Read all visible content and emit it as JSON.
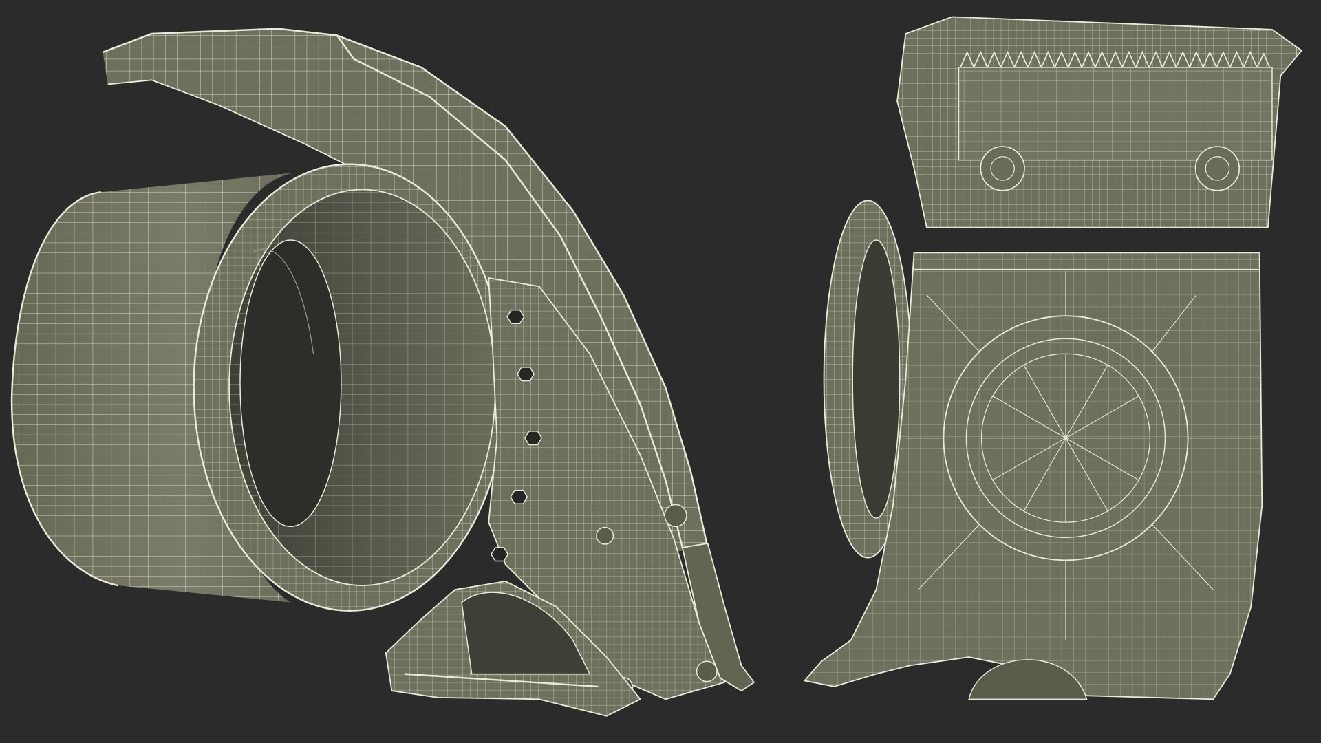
{
  "scene": {
    "description_visible_text": "",
    "palette": {
      "background": "#2b2b2b",
      "surface": "#6e705e",
      "surface_light": "#7b7d6a",
      "surface_dark": "#4c4e42",
      "shadow": "#3a3b33",
      "wire": "#e9ead8"
    },
    "objects": [
      {
        "name": "tape-dispenser-side-view"
      },
      {
        "name": "tape-dispenser-rear-view"
      }
    ]
  }
}
